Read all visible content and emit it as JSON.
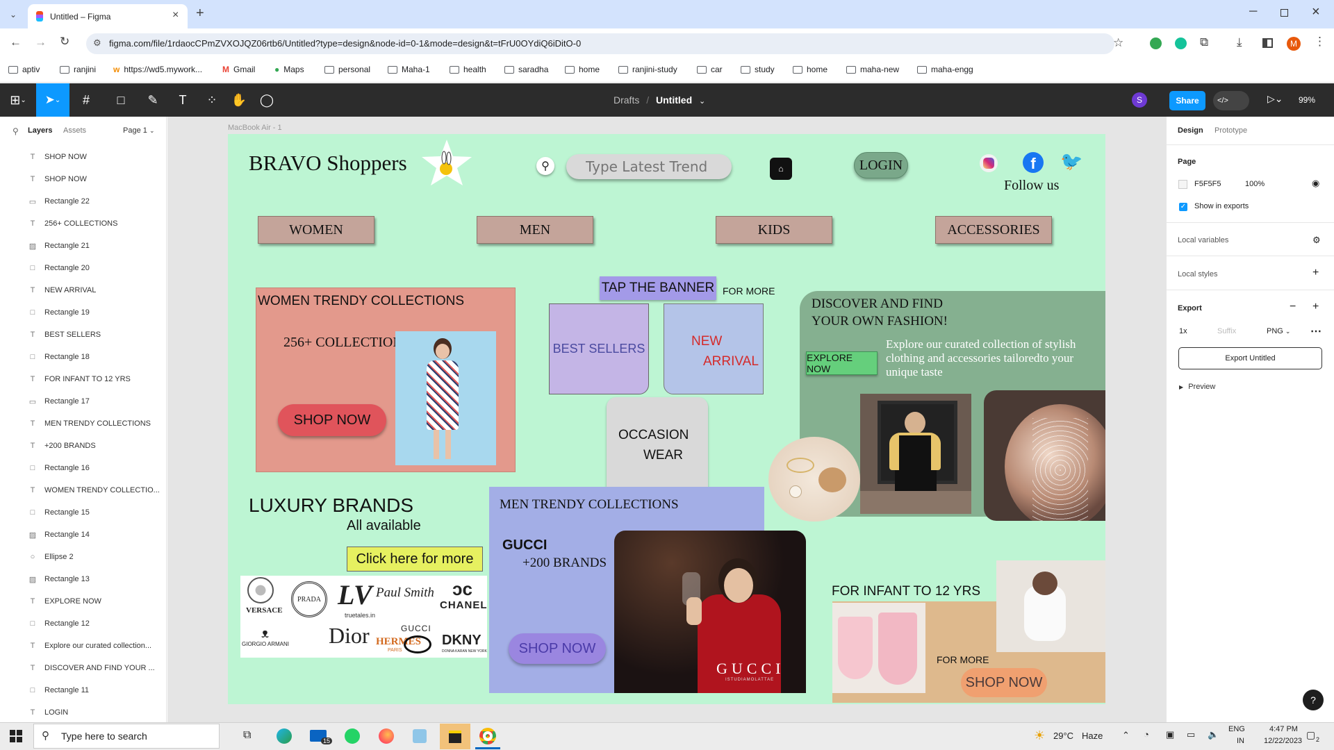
{
  "browser": {
    "tab_title": "Untitled – Figma",
    "url": "figma.com/file/1rdaocCPmZVXOJQZ06rtb6/Untitled?type=design&node-id=0-1&mode=design&t=tFrU0OYdiQ6iDitO-0",
    "profile_initial": "M"
  },
  "bookmarks": [
    "aptiv",
    "ranjini",
    "https://wd5.mywork...",
    "Gmail",
    "Maps",
    "personal",
    "Maha-1",
    "health",
    "saradha",
    "home",
    "ranjini-study",
    "car",
    "study",
    "home",
    "maha-new",
    "maha-engg"
  ],
  "toolbar": {
    "breadcrumb_drafts": "Drafts",
    "breadcrumb_sep": "/",
    "file_name": "Untitled",
    "user_initial": "S",
    "share_label": "Share",
    "zoom": "99%"
  },
  "left_panel": {
    "tab_layers": "Layers",
    "tab_assets": "Assets",
    "page_select": "Page 1",
    "layers": [
      {
        "type": "text",
        "name": "SHOP NOW"
      },
      {
        "type": "text",
        "name": "SHOP NOW"
      },
      {
        "type": "line",
        "name": "Rectangle 22"
      },
      {
        "type": "text",
        "name": "256+ COLLECTIONS"
      },
      {
        "type": "image",
        "name": "Rectangle 21"
      },
      {
        "type": "rect",
        "name": "Rectangle 20"
      },
      {
        "type": "text",
        "name": "NEW ARRIVAL"
      },
      {
        "type": "rect",
        "name": "Rectangle 19"
      },
      {
        "type": "text",
        "name": "BEST SELLERS"
      },
      {
        "type": "rect",
        "name": "Rectangle 18"
      },
      {
        "type": "text",
        "name": "FOR INFANT TO 12 YRS"
      },
      {
        "type": "line",
        "name": "Rectangle 17"
      },
      {
        "type": "text",
        "name": "MEN TRENDY COLLECTIONS"
      },
      {
        "type": "text",
        "name": "+200 BRANDS"
      },
      {
        "type": "rect",
        "name": "Rectangle 16"
      },
      {
        "type": "text",
        "name": "WOMEN TRENDY COLLECTIO..."
      },
      {
        "type": "rect",
        "name": "Rectangle 15"
      },
      {
        "type": "image",
        "name": "Rectangle 14"
      },
      {
        "type": "ellipse",
        "name": "Ellipse 2"
      },
      {
        "type": "image",
        "name": "Rectangle 13"
      },
      {
        "type": "text",
        "name": "EXPLORE NOW"
      },
      {
        "type": "rect",
        "name": "Rectangle 12"
      },
      {
        "type": "text",
        "name": "Explore our curated collection..."
      },
      {
        "type": "text",
        "name": "DISCOVER AND FIND YOUR ..."
      },
      {
        "type": "rect",
        "name": "Rectangle 11"
      },
      {
        "type": "text",
        "name": "LOGIN"
      }
    ]
  },
  "frame": {
    "label": "MacBook Air - 1",
    "brand": "BRAVO Shoppers",
    "search_placeholder": "Type Latest Trend",
    "login": "LOGIN",
    "follow_us": "Follow us",
    "categories": [
      "WOMEN",
      "MEN",
      "KIDS",
      "ACCESSORIES"
    ],
    "women": {
      "title": "WOMEN TRENDY COLLECTIONS",
      "collections": "256+ COLLECTIONS",
      "shop": "SHOP NOW"
    },
    "banner": {
      "tap": "TAP THE BANNER",
      "for_more": "FOR MORE",
      "best": "BEST SELLERS",
      "new1": "NEW",
      "new2": "ARRIVAL",
      "occ1": "OCCASION",
      "occ2": "WEAR"
    },
    "discover": {
      "title1": "DISCOVER AND FIND",
      "title2": "YOUR OWN FASHION!",
      "explore": "EXPLORE NOW",
      "text": "Explore our curated collection of stylish clothing and accessories tailoredto your unique taste"
    },
    "luxury": {
      "title": "LUXURY BRANDS",
      "sub": "All available",
      "click": "Click here for more",
      "logos": {
        "versace": "VERSACE",
        "prada": "PRADA",
        "lv": "LV",
        "lv_site": "truetales.in",
        "ps": "Paul Smith",
        "chanel": "CHANEL",
        "ga": "GIORGIO ARMANI",
        "dior": "Dior",
        "hermes": "HERMES",
        "hermes_sub": "PARIS",
        "gucci": "GUCCI",
        "dkny": "DKNY",
        "dkny_sub": "DONNA KARAN NEW YORK"
      }
    },
    "men": {
      "title": "MEN TRENDY COLLECTIONS",
      "gucci": "GUCCI",
      "brands": "+200 BRANDS",
      "shop": "SHOP NOW",
      "photo_brand": "GUCCI",
      "photo_handle": "ISTUDIAMOLATTAE"
    },
    "infant": {
      "title": "FOR INFANT TO 12 YRS",
      "for_more": "FOR MORE",
      "shop": "SHOP NOW"
    }
  },
  "right_panel": {
    "tab_design": "Design",
    "tab_prototype": "Prototype",
    "page_label": "Page",
    "page_color": "F5F5F5",
    "page_opacity": "100%",
    "show_exports": "Show in exports",
    "local_vars": "Local variables",
    "local_styles": "Local styles",
    "export": "Export",
    "scale": "1x",
    "suffix": "Suffix",
    "format": "PNG",
    "export_btn": "Export Untitled",
    "preview": "Preview"
  },
  "taskbar": {
    "search": "Type here to search",
    "mail_badge": "15",
    "temp": "29°C",
    "weather": "Haze",
    "lang1": "ENG",
    "lang2": "IN",
    "time": "4:47 PM",
    "date": "12/22/2023",
    "notif": "2"
  },
  "colors": {
    "frame_bg": "#bdf5d3",
    "share": "#0d99ff",
    "women_card": "#e3998c",
    "best": "#c4b5e6",
    "new": "#b4c4e8",
    "discover": "#85b090",
    "men_card": "#a3aee6",
    "infant": "#deb98d"
  }
}
